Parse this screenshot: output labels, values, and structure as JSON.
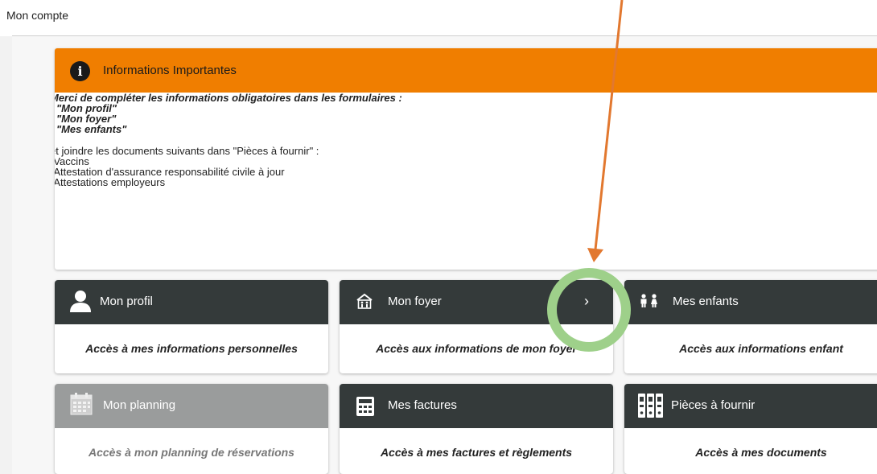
{
  "page": {
    "title": "Mon compte"
  },
  "info": {
    "title": "Informations Importantes",
    "intro": "Merci de compléter les informations obligatoires dans les formulaires :",
    "required_forms": [
      "- \"Mon profil\"",
      "- \"Mon foyer\"",
      "- \"Mes enfants\""
    ],
    "docs_intro": "et joindre les documents suivants dans \"Pièces à fournir\" :",
    "docs": [
      "-Vaccins",
      "-Attestation d'assurance responsabilité civile à jour",
      "-Attestations employeurs"
    ]
  },
  "cards": [
    {
      "title": "Mon profil",
      "desc": "Accès à mes informations personnelles",
      "icon": "user-icon"
    },
    {
      "title": "Mon foyer",
      "desc": "Accès aux informations de mon foyer",
      "icon": "home-family-icon",
      "chevron": "›"
    },
    {
      "title": "Mes enfants",
      "desc": "Accès aux informations enfant",
      "icon": "children-icon"
    },
    {
      "title": "Mon planning",
      "desc": "Accès à mon planning de réservations",
      "icon": "calendar-icon",
      "disabled": true
    },
    {
      "title": "Mes factures",
      "desc": "Accès à mes factures et règlements",
      "icon": "calculator-icon"
    },
    {
      "title": "Pièces à fournir",
      "desc": "Accès à mes documents",
      "icon": "binders-icon"
    }
  ],
  "colors": {
    "accent": "#f07e00",
    "card_header": "#343a3a",
    "card_header_disabled": "#9a9c9c",
    "annotation_arrow": "#e2782f",
    "annotation_circle": "#9ed08a"
  }
}
